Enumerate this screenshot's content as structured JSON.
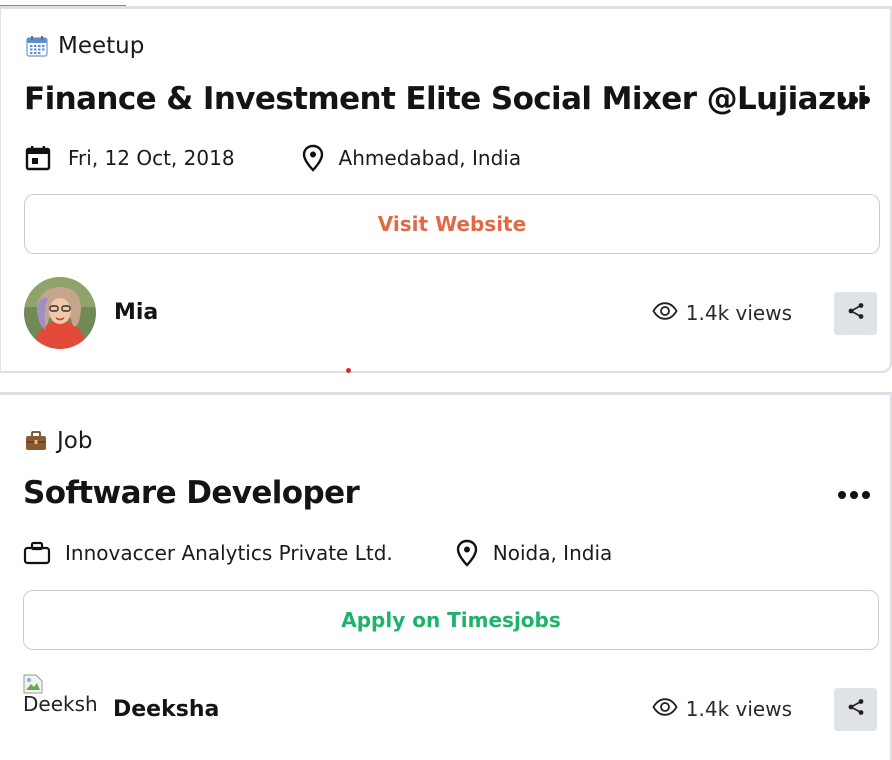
{
  "cards": [
    {
      "category": {
        "label": "Meetup",
        "icon": "calendar-emoji-icon"
      },
      "title": "Finance & Investment Elite Social Mixer @Lujiazui",
      "meta": [
        {
          "icon": "calendar-icon",
          "text": "Fri, 12 Oct, 2018"
        },
        {
          "icon": "location-pin-icon",
          "text": "Ahmedabad, India"
        }
      ],
      "action": {
        "label": "Visit Website",
        "color": "#e06a45"
      },
      "author": {
        "name": "Mia",
        "avatar": "photo"
      },
      "views": "1.4k views"
    },
    {
      "category": {
        "label": "Job",
        "icon": "briefcase-emoji-icon"
      },
      "title": "Software Developer",
      "meta": [
        {
          "icon": "briefcase-icon",
          "text": "Innovaccer Analytics Private Ltd."
        },
        {
          "icon": "location-pin-icon",
          "text": "Noida, India"
        }
      ],
      "action": {
        "label": "Apply on Timesjobs",
        "color": "#1fb26b"
      },
      "author": {
        "name": "Deeksha",
        "avatar_alt": "Deeksha"
      },
      "views": "1.4k views"
    }
  ],
  "colors": {
    "card_border": "#dcdfe3",
    "share_bg": "#dfe3e8",
    "accent_orange": "#e06a45",
    "accent_green": "#1fb26b"
  }
}
